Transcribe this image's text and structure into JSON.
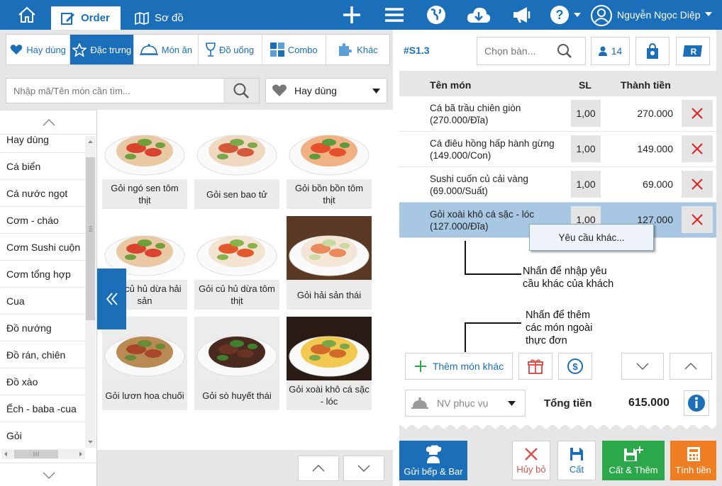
{
  "nav": {
    "tabs": [
      {
        "label": "Order"
      },
      {
        "label": "Sơ đồ"
      }
    ],
    "user_name": "Nguyễn Ngọc Diệp",
    "brand_color": "#1a6fb8"
  },
  "categories_tabs": [
    {
      "label": "Hay dùng",
      "icon": "heart-icon"
    },
    {
      "label": "Đặc trưng",
      "icon": "star-icon"
    },
    {
      "label": "Món ăn",
      "icon": "dish-icon"
    },
    {
      "label": "Đồ uống",
      "icon": "glass-icon"
    },
    {
      "label": "Combo",
      "icon": "combo-icon"
    },
    {
      "label": "Khác",
      "icon": "puzzle-icon"
    }
  ],
  "search": {
    "placeholder": "Nhập mã/Tên món cần tìm...",
    "filter_value": "Hay dùng"
  },
  "category_list": [
    "Hay dùng",
    "Cá biển",
    "Cá nước ngọt",
    "Cơm - cháo",
    "Cơm Sushi cuộn",
    "Cơm tổng hợp",
    "Cua",
    "Đồ nướng",
    "Đồ rán, chiên",
    "Đồ xào",
    "Ếch - baba -cua",
    "Gỏi"
  ],
  "dishes": [
    {
      "name": "Gỏi ngó sen tôm thịt"
    },
    {
      "name": "Gỏi sen bao tử"
    },
    {
      "name": "Gỏi bồn bồn tôm thịt"
    },
    {
      "name": "Gỏi củ hủ dừa hải sản"
    },
    {
      "name": "Gỏi củ hủ dừa tôm thịt"
    },
    {
      "name": "Gỏi hải sản thái"
    },
    {
      "name": "Gỏi lươn hoa chuối"
    },
    {
      "name": "Gỏi sò huyết thái"
    },
    {
      "name": "Gỏi xoài khô cá sặc - lóc"
    }
  ],
  "order": {
    "table_code": "#S1.3",
    "table_placeholder": "Chọn bàn...",
    "guest_count": "14",
    "r_label": "R",
    "headers": {
      "name": "Tên món",
      "qty": "SL",
      "amount": "Thành tiền"
    },
    "items": [
      {
        "name": "Cá bã trầu chiên giòn",
        "unit_price": "(270.000/Đĩa)",
        "qty": "1,00",
        "amount": "270.000",
        "selected": false
      },
      {
        "name": "Cá điêu hồng hấp hành gừng",
        "unit_price": "(149.000/Con)",
        "qty": "1,00",
        "amount": "149.000",
        "selected": false
      },
      {
        "name": "Sushi cuốn củ cải vàng",
        "unit_price": "(69.000/Suất)",
        "qty": "1,00",
        "amount": "69.000",
        "selected": false
      },
      {
        "name": "Gỏi xoài khô cá sặc - lóc",
        "unit_price": "(127.000/Đĩa)",
        "qty": "1,00",
        "amount": "127.000",
        "selected": true
      }
    ],
    "context_menu_item": "Yêu cầu khác...",
    "annotation_request": [
      "Nhấn để nhập yêu",
      "cầu khác của khách"
    ],
    "annotation_add": [
      "Nhấn để thêm",
      "các món ngoài",
      "thực đơn"
    ],
    "add_other_label": "Thêm món khác",
    "waiter_placeholder": "NV phục vụ",
    "total_label": "Tổng tiền",
    "total_value": "615.000"
  },
  "actions": {
    "send_kitchen": "Gửi bếp & Bar",
    "cancel": "Hủy bỏ",
    "save": "Cất",
    "save_add": "Cất & Thêm",
    "checkout": "Tính tiền"
  }
}
